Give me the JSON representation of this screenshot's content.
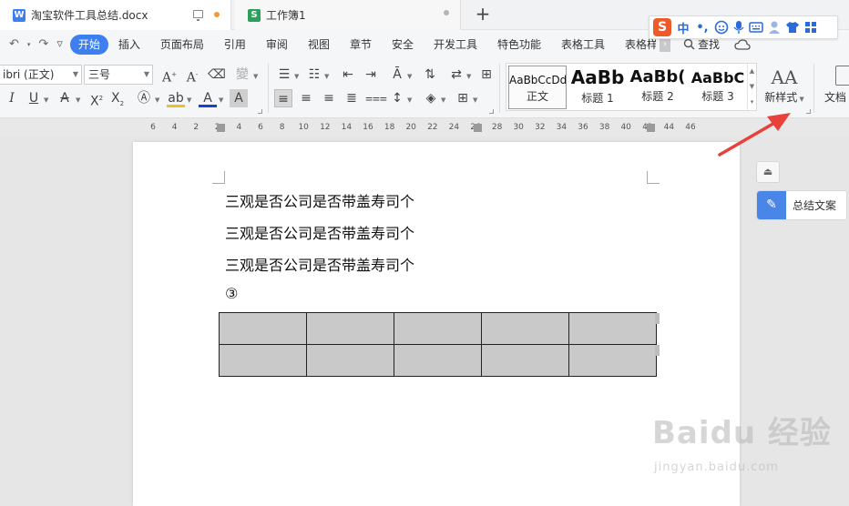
{
  "tabs": [
    {
      "icon": "W",
      "title": "淘宝软件工具总结.docx"
    },
    {
      "icon": "S",
      "title": "工作簿1"
    }
  ],
  "new_tab": "+",
  "ime": {
    "logo": "S",
    "lang": "中",
    "punct": "•,"
  },
  "quick_access": {
    "undo": "↶",
    "redo": "↷",
    "more": "▿"
  },
  "menu": {
    "items": [
      "开始",
      "插入",
      "页面布局",
      "引用",
      "审阅",
      "视图",
      "章节",
      "安全",
      "开发工具",
      "特色功能",
      "表格工具",
      "表格样式"
    ],
    "search": "查找"
  },
  "toolbar": {
    "font_name": "ibri (正文)",
    "font_size": "三号"
  },
  "styles": [
    {
      "sample": "AaBbCcDd",
      "name": "正文"
    },
    {
      "sample": "AaBb",
      "name": "标题 1"
    },
    {
      "sample": "AaBb(",
      "name": "标题 2"
    },
    {
      "sample": "AaBbC",
      "name": "标题 3"
    }
  ],
  "new_style": {
    "label": "新样式"
  },
  "doc_tool": {
    "label": "文档"
  },
  "ruler": {
    "ticks": [
      "6",
      "4",
      "2",
      "2",
      "4",
      "6",
      "8",
      "10",
      "12",
      "14",
      "16",
      "18",
      "20",
      "22",
      "24",
      "26",
      "28",
      "30",
      "32",
      "34",
      "36",
      "38",
      "40",
      "42",
      "44",
      "46"
    ]
  },
  "document": {
    "paragraphs": [
      "三观是否公司是否带盖寿司个",
      "三观是否公司是否带盖寿司个",
      "三观是否公司是否带盖寿司个"
    ],
    "number_mark": "③",
    "table": {
      "rows": 2,
      "cols": 5
    }
  },
  "side_panel": {
    "card_label": "总结文案"
  },
  "watermark": {
    "main": "Baidu 经验",
    "sub": "jingyan.baidu.com"
  },
  "colors": {
    "accent": "#3d7ef0",
    "doc_icon": "#3d7ef0",
    "sheet_icon": "#2ca05a",
    "ime_logo": "#ee5b28",
    "annotation": "#e8413c"
  }
}
